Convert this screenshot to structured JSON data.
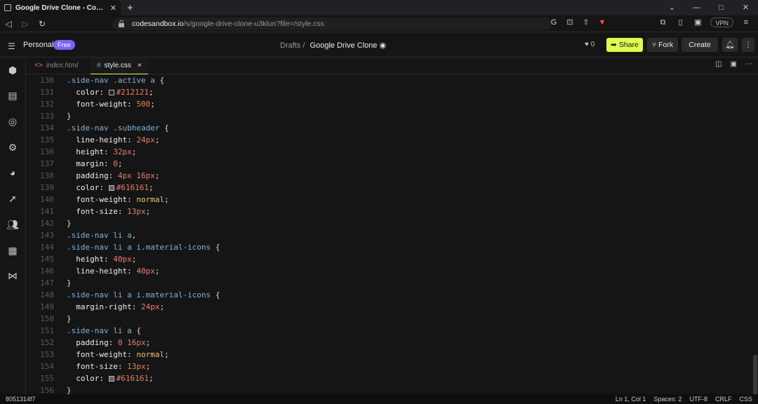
{
  "browser": {
    "tab_title": "Google Drive Clone - CodeSandbox",
    "new_tab": "+",
    "url_host": "codesandbox.io",
    "url_path": "/s/google-drive-clone-u3klun?file=/style.css",
    "vpn_label": "VPN",
    "window_controls": [
      "⌄",
      "—",
      "□",
      "✕"
    ]
  },
  "header": {
    "workspace": "Personal",
    "plan": "Free",
    "breadcrumb_root": "Drafts",
    "separator": "/",
    "project": "Google Drive Clone",
    "likes": "0",
    "share": "Share",
    "fork": "Fork",
    "create": "Create"
  },
  "editor": {
    "tabs": [
      {
        "icon": "<>",
        "label": "index.html"
      },
      {
        "icon": "#",
        "label": "style.css",
        "close": "×"
      }
    ]
  },
  "code_lines": [
    {
      "n": "130",
      "html": "<span class='sel'>.side-nav .active a</span> <span class='pun'>{</span>"
    },
    {
      "n": "131",
      "html": "  <span class='prop'>color:</span> <span class='sw' style='background:#212121'></span><span class='val'>#212121</span><span class='pun'>;</span>"
    },
    {
      "n": "132",
      "html": "  <span class='prop'>font-weight:</span> <span class='val'>500</span><span class='pun'>;</span>"
    },
    {
      "n": "133",
      "html": "<span class='pun'>}</span>"
    },
    {
      "n": "134",
      "html": "<span class='sel'>.side-nav .subheader</span> <span class='pun'>{</span>"
    },
    {
      "n": "135",
      "html": "  <span class='prop'>line-height:</span> <span class='val'>24px</span><span class='pun'>;</span>"
    },
    {
      "n": "136",
      "html": "  <span class='prop'>height:</span> <span class='val'>32px</span><span class='pun'>;</span>"
    },
    {
      "n": "137",
      "html": "  <span class='prop'>margin:</span> <span class='val'>0</span><span class='pun'>;</span>"
    },
    {
      "n": "138",
      "html": "  <span class='prop'>padding:</span> <span class='val'>4px 16px</span><span class='pun'>;</span>"
    },
    {
      "n": "139",
      "html": "  <span class='prop'>color:</span> <span class='sw' style='background:#616161'></span><span class='val'>#616161</span><span class='pun'>;</span>"
    },
    {
      "n": "140",
      "html": "  <span class='prop'>font-weight:</span> <span class='kw'>normal</span><span class='pun'>;</span>"
    },
    {
      "n": "141",
      "html": "  <span class='prop'>font-size:</span> <span class='val'>13px</span><span class='pun'>;</span>"
    },
    {
      "n": "142",
      "html": "<span class='pun'>}</span>"
    },
    {
      "n": "143",
      "html": "<span class='sel'>.side-nav li a</span><span class='pun'>,</span>"
    },
    {
      "n": "144",
      "html": "<span class='sel'>.side-nav li a i.material-icons</span> <span class='pun'>{</span>"
    },
    {
      "n": "145",
      "html": "  <span class='prop'>height:</span> <span class='val'>40px</span><span class='pun'>;</span>"
    },
    {
      "n": "146",
      "html": "  <span class='prop'>line-height:</span> <span class='val'>40px</span><span class='pun'>;</span>"
    },
    {
      "n": "147",
      "html": "<span class='pun'>}</span>"
    },
    {
      "n": "148",
      "html": "<span class='sel'>.side-nav li a i.material-icons</span> <span class='pun'>{</span>"
    },
    {
      "n": "149",
      "html": "  <span class='prop'>margin-right:</span> <span class='val'>24px</span><span class='pun'>;</span>"
    },
    {
      "n": "150",
      "html": "<span class='pun'>}</span>"
    },
    {
      "n": "151",
      "html": "<span class='sel'>.side-nav li a</span> <span class='pun'>{</span>"
    },
    {
      "n": "152",
      "html": "  <span class='prop'>padding:</span> <span class='val'>0 16px</span><span class='pun'>;</span>"
    },
    {
      "n": "153",
      "html": "  <span class='prop'>font-weight:</span> <span class='kw'>normal</span><span class='pun'>;</span>"
    },
    {
      "n": "154",
      "html": "  <span class='prop'>font-size:</span> <span class='val'>13px</span><span class='pun'>;</span>"
    },
    {
      "n": "155",
      "html": "  <span class='prop'>color:</span> <span class='sw' style='background:#616161'></span><span class='val'>#616161</span><span class='pun'>;</span>"
    },
    {
      "n": "156",
      "html": "<span class='pun'>}</span>"
    }
  ],
  "status": {
    "hash": "8051314f7",
    "items": [
      "Ln 1, Col 1",
      "Spaces: 2",
      "UTF-8",
      "CRLF",
      "CSS"
    ]
  },
  "colors": {
    "accent": "#dcff50",
    "badge": "#7b61ff"
  }
}
